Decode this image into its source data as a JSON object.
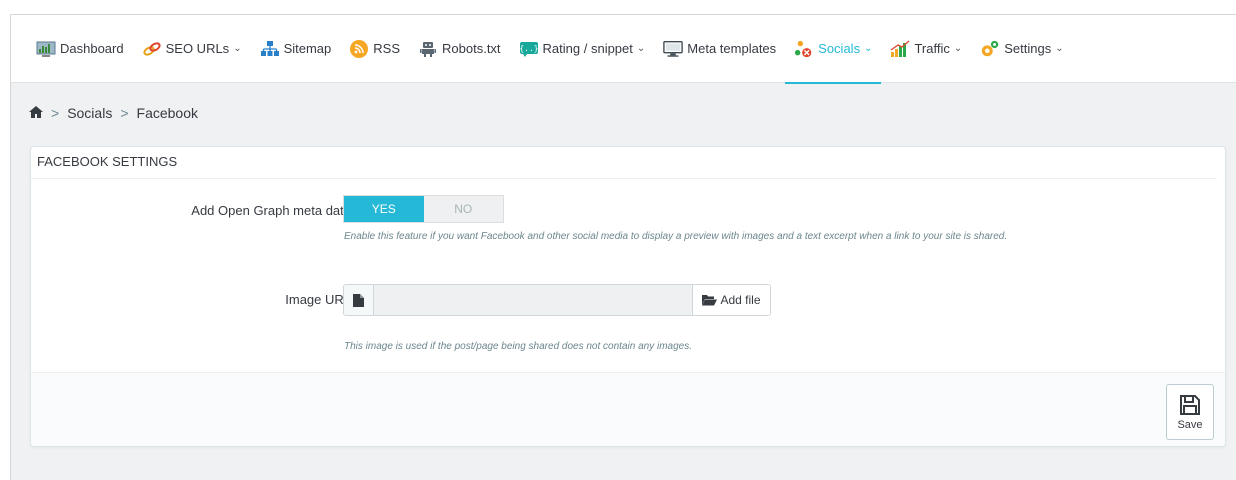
{
  "nav": {
    "items": [
      {
        "label": "Dashboard",
        "icon": "dashboard-icon",
        "caret": false
      },
      {
        "label": "SEO URLs",
        "icon": "link-icon",
        "caret": true
      },
      {
        "label": "Sitemap",
        "icon": "sitemap-icon",
        "caret": false
      },
      {
        "label": "RSS",
        "icon": "rss-icon",
        "caret": false
      },
      {
        "label": "Robots.txt",
        "icon": "robot-icon",
        "caret": false
      },
      {
        "label": "Rating / snippet",
        "icon": "snippet-icon",
        "caret": true
      },
      {
        "label": "Meta templates",
        "icon": "monitor-icon",
        "caret": false
      },
      {
        "label": "Socials",
        "icon": "socials-icon",
        "caret": true,
        "active": true
      },
      {
        "label": "Traffic",
        "icon": "bar-chart-icon",
        "caret": true
      },
      {
        "label": "Settings",
        "icon": "gear-icon",
        "caret": true
      }
    ]
  },
  "breadcrumb": {
    "home_icon": "home-icon",
    "items": [
      "Socials",
      "Facebook"
    ]
  },
  "panel": {
    "title": "FACEBOOK SETTINGS",
    "og": {
      "label": "Add Open Graph meta data",
      "yes": "YES",
      "no": "NO",
      "selected": "YES",
      "help": "Enable this feature if you want Facebook and other social media to display a preview with images and a text excerpt when a link to your site is shared."
    },
    "image": {
      "label": "Image URL",
      "value": "",
      "add_label": "Add file",
      "help": "This image is used if the post/page being shared does not contain any images."
    },
    "save_label": "Save"
  },
  "colors": {
    "accent": "#25b9d7",
    "text": "#363a41",
    "muted": "#6c868e",
    "background": "#eff1f2"
  }
}
